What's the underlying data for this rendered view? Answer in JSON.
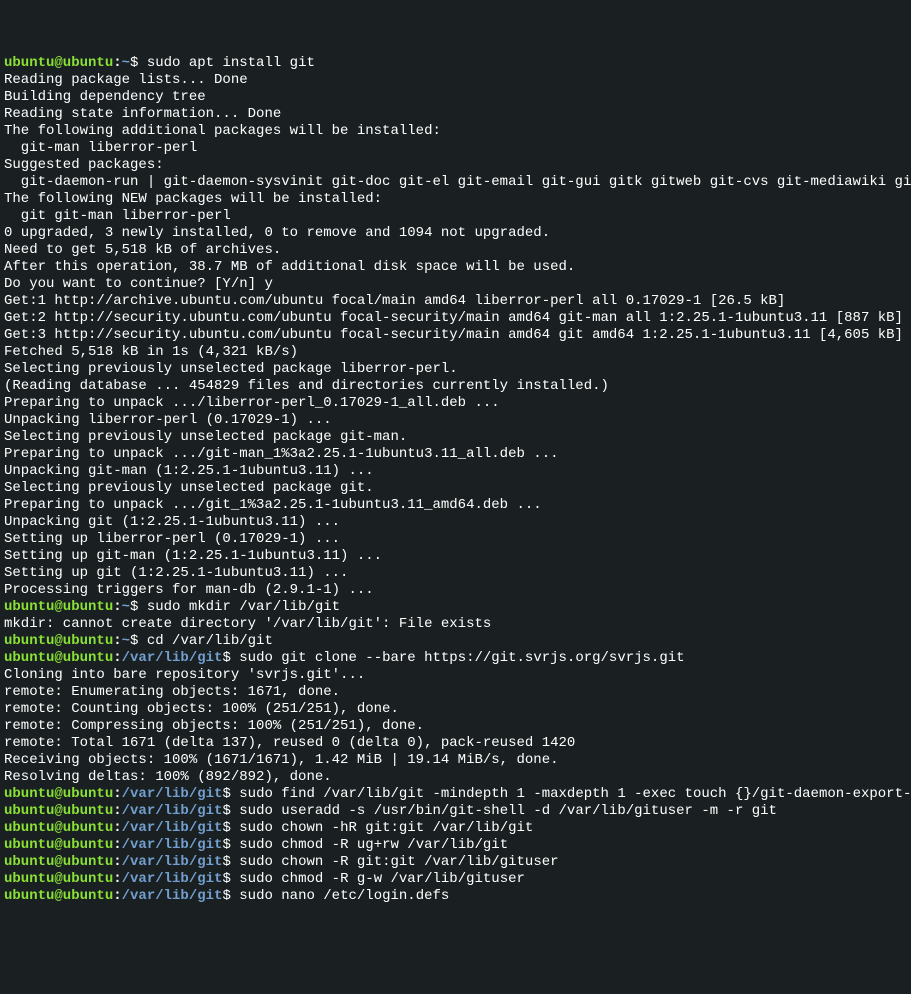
{
  "lines": [
    {
      "type": "prompt",
      "user": "ubuntu@ubuntu",
      "path": "~",
      "cmd": "sudo apt install git"
    },
    {
      "type": "output",
      "text": "Reading package lists... Done"
    },
    {
      "type": "output",
      "text": "Building dependency tree"
    },
    {
      "type": "output",
      "text": "Reading state information... Done"
    },
    {
      "type": "output",
      "text": "The following additional packages will be installed:"
    },
    {
      "type": "output",
      "text": "  git-man liberror-perl"
    },
    {
      "type": "output",
      "text": "Suggested packages:"
    },
    {
      "type": "output",
      "text": "  git-daemon-run | git-daemon-sysvinit git-doc git-el git-email git-gui gitk gitweb git-cvs git-mediawiki git-svn"
    },
    {
      "type": "output",
      "text": "The following NEW packages will be installed:"
    },
    {
      "type": "output",
      "text": "  git git-man liberror-perl"
    },
    {
      "type": "output",
      "text": "0 upgraded, 3 newly installed, 0 to remove and 1094 not upgraded."
    },
    {
      "type": "output",
      "text": "Need to get 5,518 kB of archives."
    },
    {
      "type": "output",
      "text": "After this operation, 38.7 MB of additional disk space will be used."
    },
    {
      "type": "output",
      "text": "Do you want to continue? [Y/n] y"
    },
    {
      "type": "output",
      "text": "Get:1 http://archive.ubuntu.com/ubuntu focal/main amd64 liberror-perl all 0.17029-1 [26.5 kB]"
    },
    {
      "type": "output",
      "text": "Get:2 http://security.ubuntu.com/ubuntu focal-security/main amd64 git-man all 1:2.25.1-1ubuntu3.11 [887 kB]"
    },
    {
      "type": "output",
      "text": "Get:3 http://security.ubuntu.com/ubuntu focal-security/main amd64 git amd64 1:2.25.1-1ubuntu3.11 [4,605 kB]"
    },
    {
      "type": "output",
      "text": "Fetched 5,518 kB in 1s (4,321 kB/s)"
    },
    {
      "type": "output",
      "text": "Selecting previously unselected package liberror-perl."
    },
    {
      "type": "output",
      "text": "(Reading database ... 454829 files and directories currently installed.)"
    },
    {
      "type": "output",
      "text": "Preparing to unpack .../liberror-perl_0.17029-1_all.deb ..."
    },
    {
      "type": "output",
      "text": "Unpacking liberror-perl (0.17029-1) ..."
    },
    {
      "type": "output",
      "text": "Selecting previously unselected package git-man."
    },
    {
      "type": "output",
      "text": "Preparing to unpack .../git-man_1%3a2.25.1-1ubuntu3.11_all.deb ..."
    },
    {
      "type": "output",
      "text": "Unpacking git-man (1:2.25.1-1ubuntu3.11) ..."
    },
    {
      "type": "output",
      "text": "Selecting previously unselected package git."
    },
    {
      "type": "output",
      "text": "Preparing to unpack .../git_1%3a2.25.1-1ubuntu3.11_amd64.deb ..."
    },
    {
      "type": "output",
      "text": "Unpacking git (1:2.25.1-1ubuntu3.11) ..."
    },
    {
      "type": "output",
      "text": "Setting up liberror-perl (0.17029-1) ..."
    },
    {
      "type": "output",
      "text": "Setting up git-man (1:2.25.1-1ubuntu3.11) ..."
    },
    {
      "type": "output",
      "text": "Setting up git (1:2.25.1-1ubuntu3.11) ..."
    },
    {
      "type": "output",
      "text": "Processing triggers for man-db (2.9.1-1) ..."
    },
    {
      "type": "prompt",
      "user": "ubuntu@ubuntu",
      "path": "~",
      "cmd": "sudo mkdir /var/lib/git"
    },
    {
      "type": "output",
      "text": "mkdir: cannot create directory '/var/lib/git': File exists"
    },
    {
      "type": "prompt",
      "user": "ubuntu@ubuntu",
      "path": "~",
      "cmd": "cd /var/lib/git"
    },
    {
      "type": "prompt",
      "user": "ubuntu@ubuntu",
      "path": "/var/lib/git",
      "cmd": "sudo git clone --bare https://git.svrjs.org/svrjs.git"
    },
    {
      "type": "output",
      "text": "Cloning into bare repository 'svrjs.git'..."
    },
    {
      "type": "output",
      "text": "remote: Enumerating objects: 1671, done."
    },
    {
      "type": "output",
      "text": "remote: Counting objects: 100% (251/251), done."
    },
    {
      "type": "output",
      "text": "remote: Compressing objects: 100% (251/251), done."
    },
    {
      "type": "output",
      "text": "remote: Total 1671 (delta 137), reused 0 (delta 0), pack-reused 1420"
    },
    {
      "type": "output",
      "text": "Receiving objects: 100% (1671/1671), 1.42 MiB | 19.14 MiB/s, done."
    },
    {
      "type": "output",
      "text": "Resolving deltas: 100% (892/892), done."
    },
    {
      "type": "prompt",
      "user": "ubuntu@ubuntu",
      "path": "/var/lib/git",
      "cmd": "sudo find /var/lib/git -mindepth 1 -maxdepth 1 -exec touch {}/git-daemon-export-ok \\;"
    },
    {
      "type": "prompt",
      "user": "ubuntu@ubuntu",
      "path": "/var/lib/git",
      "cmd": "sudo useradd -s /usr/bin/git-shell -d /var/lib/gituser -m -r git"
    },
    {
      "type": "prompt",
      "user": "ubuntu@ubuntu",
      "path": "/var/lib/git",
      "cmd": "sudo chown -hR git:git /var/lib/git"
    },
    {
      "type": "prompt",
      "user": "ubuntu@ubuntu",
      "path": "/var/lib/git",
      "cmd": "sudo chmod -R ug+rw /var/lib/git"
    },
    {
      "type": "prompt",
      "user": "ubuntu@ubuntu",
      "path": "/var/lib/git",
      "cmd": "sudo chown -R git:git /var/lib/gituser"
    },
    {
      "type": "prompt",
      "user": "ubuntu@ubuntu",
      "path": "/var/lib/git",
      "cmd": "sudo chmod -R g-w /var/lib/gituser"
    },
    {
      "type": "prompt",
      "user": "ubuntu@ubuntu",
      "path": "/var/lib/git",
      "cmd": "sudo nano /etc/login.defs"
    }
  ]
}
